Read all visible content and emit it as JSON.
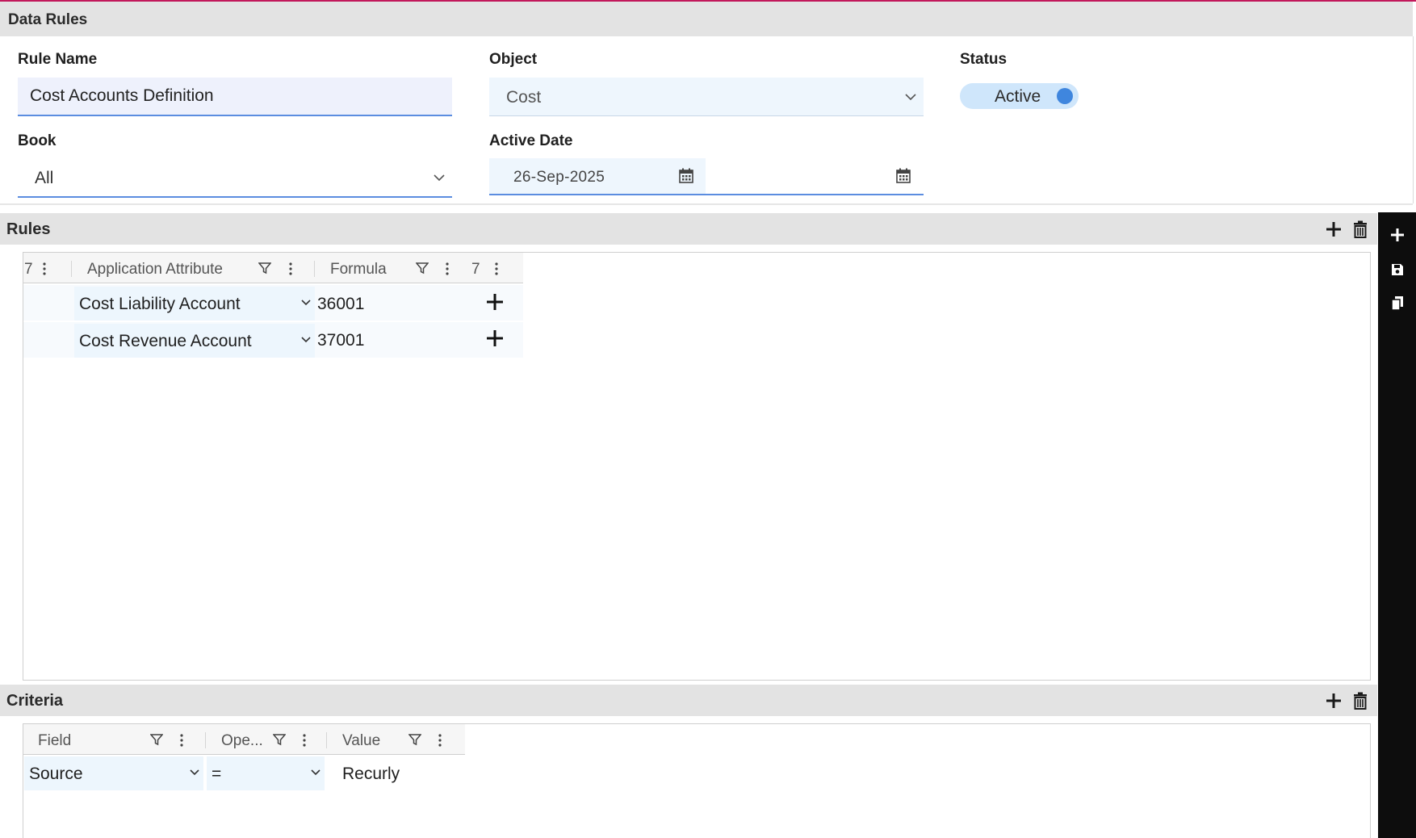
{
  "header": {
    "title": "Data Rules"
  },
  "form": {
    "rule_name_label": "Rule Name",
    "rule_name_value": "Cost Accounts Definition",
    "object_label": "Object",
    "object_value": "Cost",
    "status_label": "Status",
    "status_value": "Active",
    "book_label": "Book",
    "book_value": "All",
    "active_date_label": "Active Date",
    "active_date_value": "26-Sep-2025"
  },
  "rules": {
    "title": "Rules",
    "columns": {
      "c0": "7",
      "application_attribute": "Application Attribute",
      "formula": "Formula",
      "c3": "7"
    },
    "rows": [
      {
        "attribute": "Cost Liability Account",
        "formula": "36001"
      },
      {
        "attribute": "Cost Revenue Account",
        "formula": "37001"
      }
    ]
  },
  "criteria": {
    "title": "Criteria",
    "columns": {
      "field": "Field",
      "operator": "Ope...",
      "value": "Value"
    },
    "rows": [
      {
        "field": "Source",
        "operator": "=",
        "value": "Recurly"
      }
    ]
  },
  "colors": {
    "accent": "#3f86de",
    "top_line": "#c2185b",
    "rail": "#0d0d0d"
  },
  "icons": [
    "chevron-down-icon",
    "calendar-icon",
    "plus-icon",
    "trash-icon",
    "save-icon",
    "copy-icon",
    "filter-icon",
    "kebab-icon"
  ]
}
